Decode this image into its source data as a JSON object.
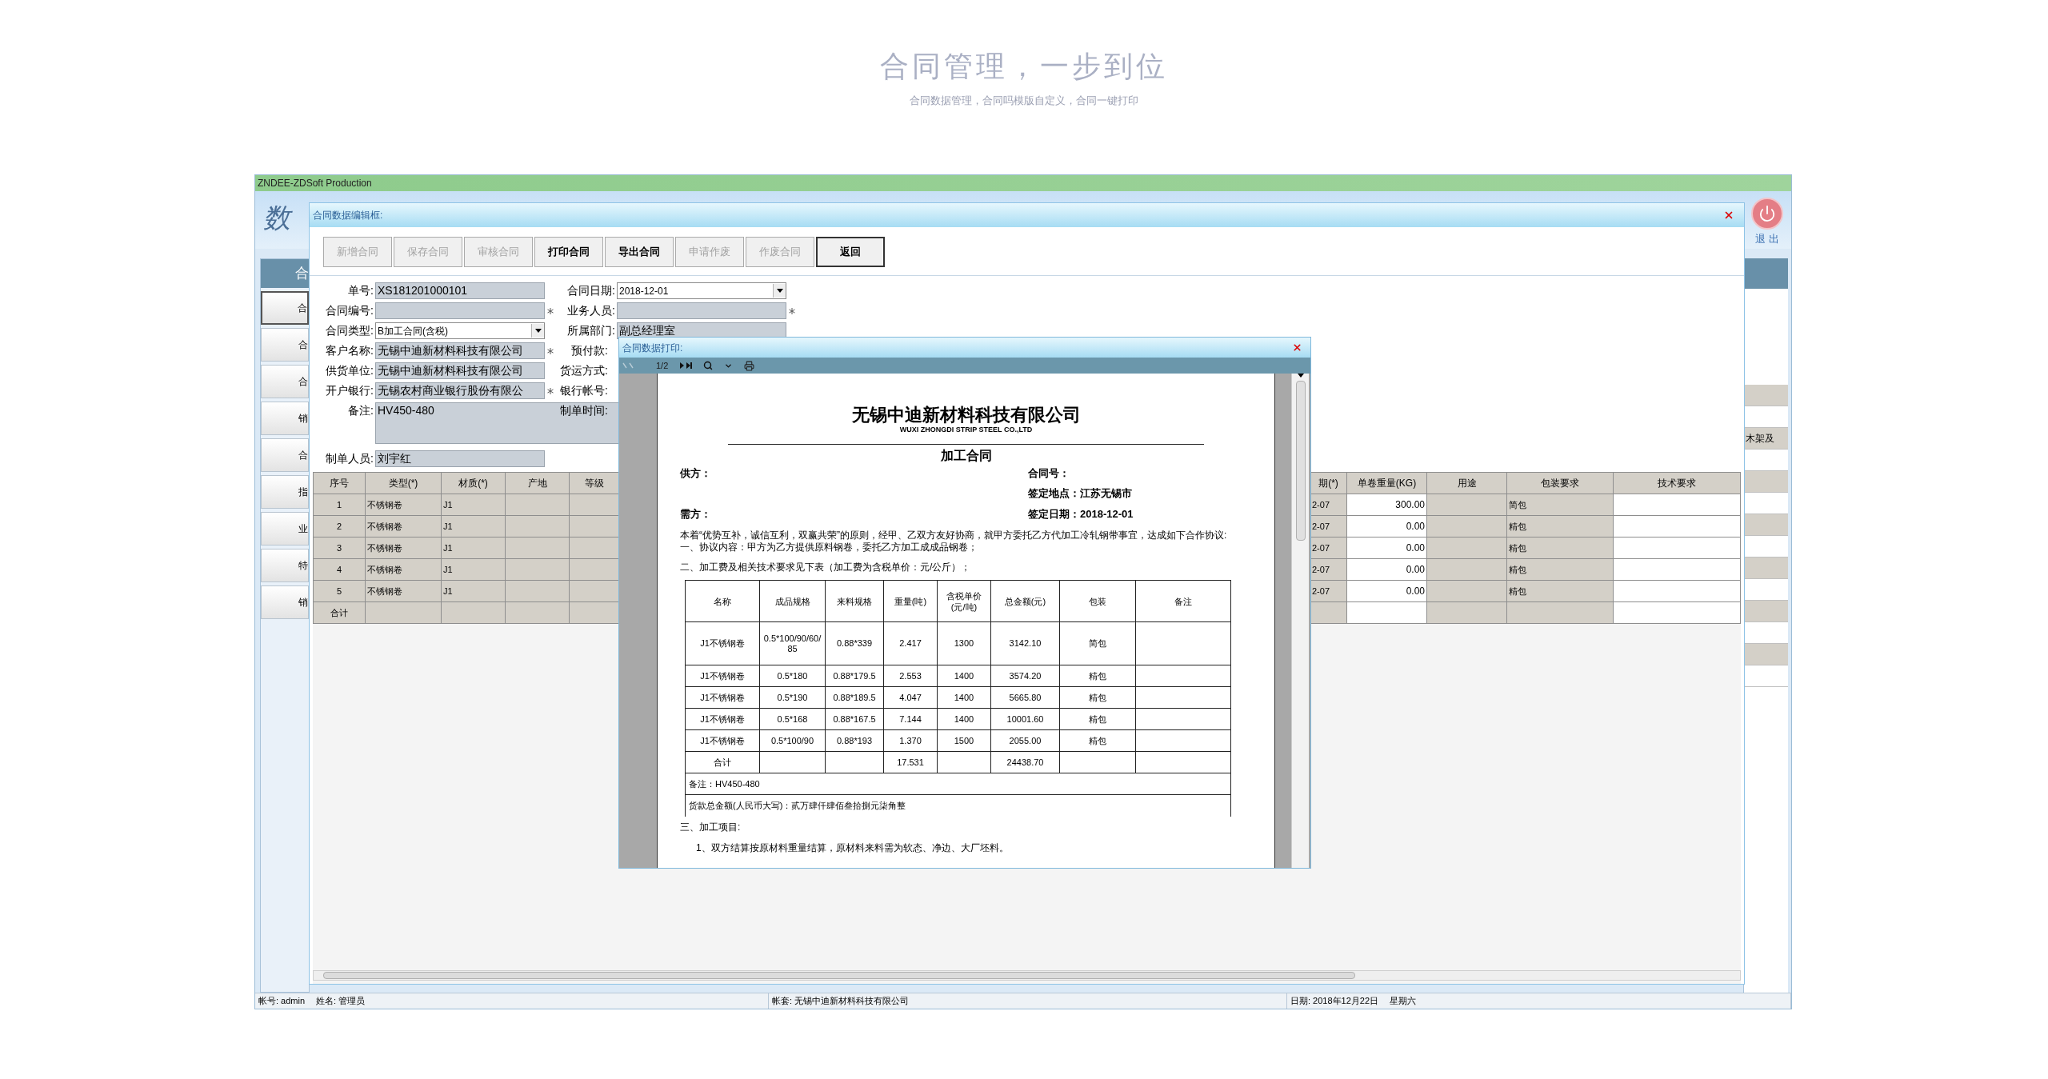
{
  "banner": {
    "title": "合同管理，一步到位",
    "subtitle": "合同数据管理，合同吗模版自定义，合同一键打印"
  },
  "app": {
    "title": "ZNDEE-ZDSoft Production",
    "logo_text": "数",
    "exit_label": "退 出",
    "sidebar": {
      "header": "合",
      "items": [
        {
          "label": "合",
          "selected": true
        },
        {
          "label": "合",
          "selected": false
        },
        {
          "label": "合",
          "selected": false
        },
        {
          "label": "销",
          "selected": false
        },
        {
          "label": "合",
          "selected": false
        },
        {
          "label": "指",
          "selected": false
        },
        {
          "label": "业",
          "selected": false
        },
        {
          "label": "特",
          "selected": false
        },
        {
          "label": "销",
          "selected": false
        }
      ]
    },
    "right_panel": {
      "label": "木架及"
    }
  },
  "edit_dialog": {
    "title": "合同数据编辑框:",
    "toolbar": [
      {
        "label": "新增合同",
        "disabled": true,
        "focused": false
      },
      {
        "label": "保存合同",
        "disabled": true,
        "focused": false
      },
      {
        "label": "审核合同",
        "disabled": true,
        "focused": false
      },
      {
        "label": "打印合同",
        "disabled": false,
        "focused": false
      },
      {
        "label": "导出合同",
        "disabled": false,
        "focused": false
      },
      {
        "label": "申请作废",
        "disabled": true,
        "focused": false
      },
      {
        "label": "作废合同",
        "disabled": true,
        "focused": false
      },
      {
        "label": "返回",
        "disabled": false,
        "focused": true
      }
    ],
    "form_left": [
      {
        "label": "单号:",
        "value": "XS181201000101",
        "kind": "text",
        "required": false
      },
      {
        "label": "合同编号:",
        "kind": "text",
        "required": true
      },
      {
        "label": "合同类型:",
        "value": "B加工合同(含税)",
        "kind": "select",
        "required": false
      },
      {
        "label": "客户名称:",
        "value": "无锡中迪新材料科技有限公司",
        "kind": "text",
        "required": true
      },
      {
        "label": "供货单位:",
        "value": "无锡中迪新材料科技有限公司",
        "kind": "text",
        "required": false
      },
      {
        "label": "开户银行:",
        "value": "无锡农村商业银行股份有限公",
        "kind": "text",
        "required": true
      },
      {
        "label": "备注:",
        "value": "HV450-480",
        "kind": "textarea"
      },
      {
        "label": "制单人员:",
        "value": "刘宇红",
        "kind": "text",
        "required": false
      }
    ],
    "form_right": [
      {
        "label": "合同日期:",
        "value": "2018-12-01",
        "kind": "select",
        "required": false
      },
      {
        "label": "业务人员:",
        "kind": "text",
        "required": true
      },
      {
        "label": "所属部门:",
        "value": "副总经理室",
        "kind": "text",
        "required": false
      },
      {
        "label": "预付款:",
        "kind": "covered"
      },
      {
        "label": "货运方式:",
        "kind": "covered"
      },
      {
        "label": "银行帐号:",
        "kind": "covered"
      },
      {
        "label": "制单时间:",
        "kind": "covered"
      }
    ],
    "grid": {
      "left_columns": [
        {
          "label": "序号",
          "editable": false
        },
        {
          "label": "类型(*)",
          "editable": false
        },
        {
          "label": "材质(*)",
          "editable": false
        },
        {
          "label": "产地",
          "editable": false
        },
        {
          "label": "等级",
          "editable": false
        }
      ],
      "right_columns": [
        {
          "label": "期(*)",
          "editable": false
        },
        {
          "label": "单卷重量(KG)",
          "editable": true
        },
        {
          "label": "用途",
          "editable": false
        },
        {
          "label": "包装要求",
          "editable": false
        },
        {
          "label": "技术要求",
          "editable": true
        }
      ],
      "rows": [
        {
          "no": "1",
          "type": "不锈钢卷",
          "material": "J1",
          "date": "2-07",
          "weight": "300.00",
          "packing": "简包"
        },
        {
          "no": "2",
          "type": "不锈钢卷",
          "material": "J1",
          "date": "2-07",
          "weight": "0.00",
          "packing": "精包"
        },
        {
          "no": "3",
          "type": "不锈钢卷",
          "material": "J1",
          "date": "2-07",
          "weight": "0.00",
          "packing": "精包"
        },
        {
          "no": "4",
          "type": "不锈钢卷",
          "material": "J1",
          "date": "2-07",
          "weight": "0.00",
          "packing": "精包"
        },
        {
          "no": "5",
          "type": "不锈钢卷",
          "material": "J1",
          "date": "2-07",
          "weight": "0.00",
          "packing": "精包"
        }
      ],
      "total_label": "合计"
    }
  },
  "print_dialog": {
    "title": "合同数据打印:",
    "page": "1/2",
    "document": {
      "company": "无锡中迪新材料科技有限公司",
      "company_en": "WUXI ZHONGDI STRIP STEEL CO.,LTD",
      "title": "加工合同",
      "supplier_label": "供方：",
      "contract_no_label": "合同号：",
      "place": "签定地点：江苏无锡市",
      "buyer_label": "需方：",
      "date": "签定日期：2018-12-01",
      "paragraphs": [
        "本着“优势互补，诚信互利，双赢共荣”的原则，经甲、乙双方友好协商，就甲方委托乙方代加工冷轧钢带事宜，达成如下合作协议:",
        "一、协议内容：甲方为乙方提供原料钢卷，委托乙方加工成成品钢卷；",
        "二、加工费及相关技术要求见下表（加工费为含税单价：元/公斤）；"
      ],
      "table": {
        "columns": [
          "名称",
          "成品规格",
          "来料规格",
          "重量(吨)",
          "含税单价(元/吨)",
          "总金额(元)",
          "包装",
          "备注"
        ],
        "rows": [
          {
            "name": "J1不锈钢卷",
            "spec": "0.5*100/90/60/85",
            "raw": "0.88*339",
            "weight": "2.417",
            "price": "1300",
            "amount": "3142.10",
            "packing": "简包"
          },
          {
            "name": "J1不锈钢卷",
            "spec": "0.5*180",
            "raw": "0.88*179.5",
            "weight": "2.553",
            "price": "1400",
            "amount": "3574.20",
            "packing": "精包"
          },
          {
            "name": "J1不锈钢卷",
            "spec": "0.5*190",
            "raw": "0.88*189.5",
            "weight": "4.047",
            "price": "1400",
            "amount": "5665.80",
            "packing": "精包"
          },
          {
            "name": "J1不锈钢卷",
            "spec": "0.5*168",
            "raw": "0.88*167.5",
            "weight": "7.144",
            "price": "1400",
            "amount": "10001.60",
            "packing": "精包"
          },
          {
            "name": "J1不锈钢卷",
            "spec": "0.5*100/90",
            "raw": "0.88*193",
            "weight": "1.370",
            "price": "1500",
            "amount": "2055.00",
            "packing": "精包"
          }
        ],
        "total": {
          "name": "合计",
          "weight": "17.531",
          "amount": "24438.70"
        },
        "note": "备注：HV450-480",
        "amount": "货款总金额(人民币大写)：贰万肆仟肆佰叁拾捌元柒角整"
      },
      "after": [
        "三、加工项目:",
        "1、双方结算按原材料重量结算，原材料来料需为软态、净边、大厂坯料。"
      ]
    }
  },
  "status_bar": [
    [
      "帐号: admin",
      "姓名: 管理员"
    ],
    [
      "帐套: 无锡中迪新材料科技有限公司"
    ],
    [
      "日期: 2018年12月22日",
      "星期六"
    ]
  ]
}
